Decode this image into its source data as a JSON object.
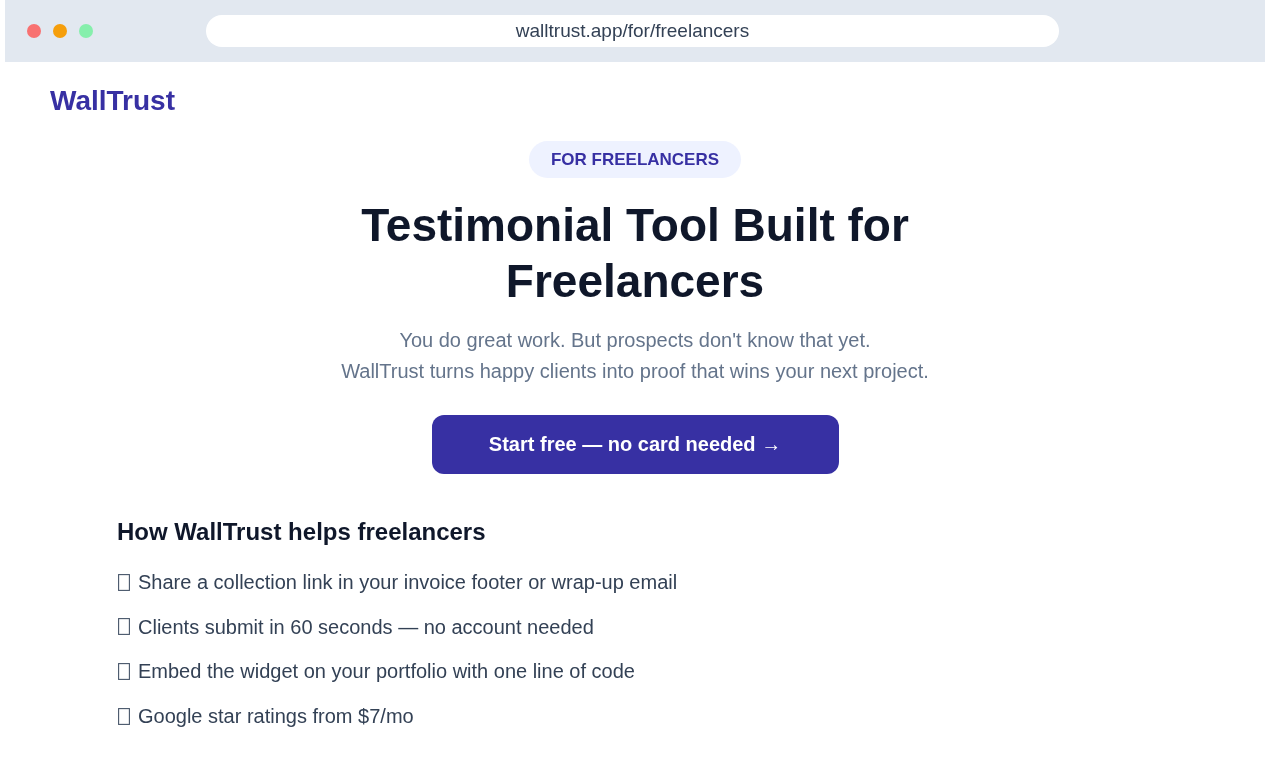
{
  "browser": {
    "window_controls": [
      {
        "color": "#f87171"
      },
      {
        "color": "#f59e0b"
      },
      {
        "color": "#86efac"
      }
    ],
    "url": "walltrust.app/for/freelancers"
  },
  "header": {
    "logo": "WallTrust"
  },
  "hero": {
    "badge": "FOR FREELANCERS",
    "title": "Testimonial Tool Built for Freelancers",
    "subtitle_lines": [
      "You do great work. But prospects don't know that yet.",
      "WallTrust turns happy clients into proof that wins your next project."
    ],
    "cta": "Start free — no card needed →"
  },
  "benefits": {
    "heading": "How WallTrust helps freelancers",
    "items": [
      {
        "text": "Share a collection link in your invoice footer or wrap-up email"
      },
      {
        "text": "Clients submit in 60 seconds — no account needed"
      },
      {
        "text": "Embed the widget on your portfolio with one line of code"
      },
      {
        "text": "Google star ratings from $7/mo"
      }
    ]
  }
}
